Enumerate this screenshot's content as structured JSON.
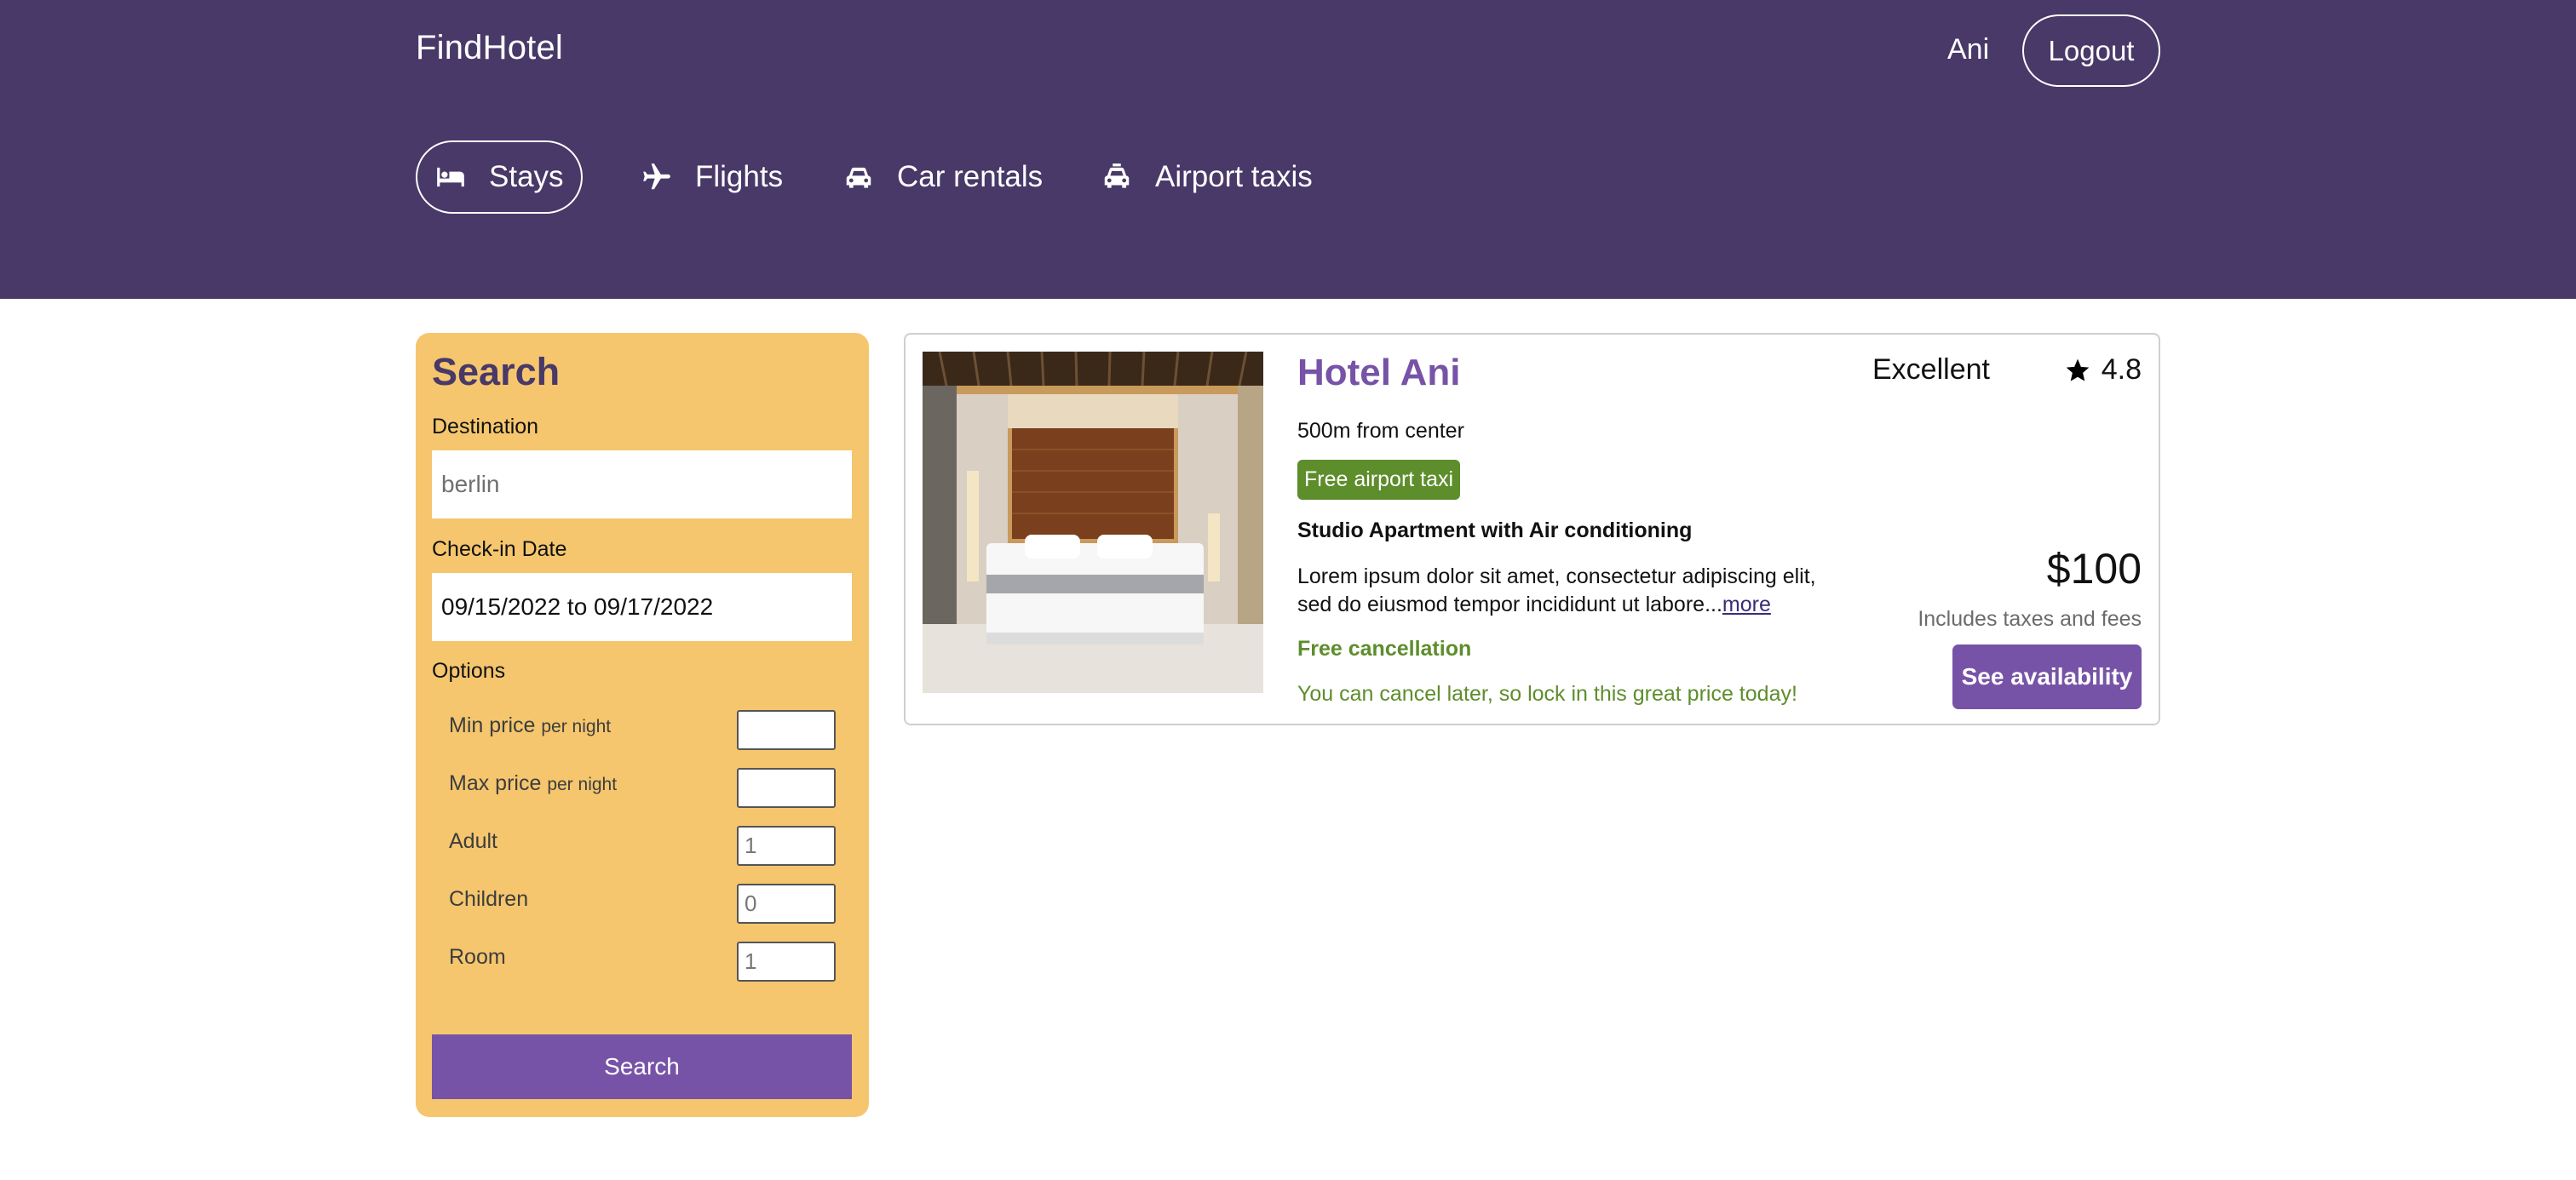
{
  "header": {
    "brand": "FindHotel",
    "user_name": "Ani",
    "logout_label": "Logout",
    "nav": [
      {
        "label": "Stays",
        "icon": "bed-icon",
        "active": true
      },
      {
        "label": "Flights",
        "icon": "plane-icon",
        "active": false
      },
      {
        "label": "Car rentals",
        "icon": "car-icon",
        "active": false
      },
      {
        "label": "Airport taxis",
        "icon": "taxi-icon",
        "active": false
      }
    ]
  },
  "search": {
    "title": "Search",
    "destination_label": "Destination",
    "destination_placeholder": "berlin",
    "checkin_label": "Check-in Date",
    "checkin_value": "09/15/2022 to 09/17/2022",
    "options_label": "Options",
    "options": [
      {
        "label": "Min price",
        "sub": "per night",
        "value": ""
      },
      {
        "label": "Max price",
        "sub": "per night",
        "value": ""
      },
      {
        "label": "Adult",
        "sub": "",
        "value": "1"
      },
      {
        "label": "Children",
        "sub": "",
        "value": "0"
      },
      {
        "label": "Room",
        "sub": "",
        "value": "1"
      }
    ],
    "button_label": "Search"
  },
  "result": {
    "name": "Hotel Ani",
    "distance": "500m from center",
    "taxi_badge": "Free airport taxi",
    "room_type": "Studio Apartment with Air conditioning",
    "description": "Lorem ipsum dolor sit amet, consectetur adipiscing elit, sed do eiusmod tempor incididunt ut labore...",
    "more_label": "more",
    "free_cancellation": "Free cancellation",
    "cancel_note": "You can cancel later, so lock in this great price today!",
    "rating_text": "Excellent",
    "rating_score": "4.8",
    "price": "$100",
    "tax_note": "Includes taxes and fees",
    "availability_label": "See availability"
  },
  "colors": {
    "header_bg": "#483968",
    "accent_purple": "#7753a7",
    "sidebar_bg": "#f5c66e",
    "green": "#5e8d2c"
  }
}
